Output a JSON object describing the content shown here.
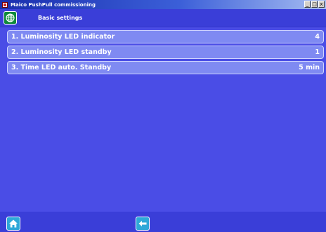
{
  "window": {
    "title": "Maico PushPull commissioning",
    "buttons": {
      "minimize": "_",
      "maximize": "□",
      "close": "x"
    }
  },
  "header": {
    "title": "Basic settings",
    "globe_icon": "globe-icon"
  },
  "settings": [
    {
      "label": "1. Luminosity LED indicator",
      "value": "4"
    },
    {
      "label": "2. Luminosity LED standby",
      "value": "1"
    },
    {
      "label": "3. Time LED auto. Standby",
      "value": "5 min"
    }
  ],
  "footer": {
    "home_icon": "home-icon",
    "back_icon": "arrow-left-icon"
  },
  "colors": {
    "background": "#4a4de6",
    "bar": "#3a3ed8",
    "row": "#7f8af2",
    "button": "#2ea8d8",
    "globe": "#0f8a3a"
  }
}
